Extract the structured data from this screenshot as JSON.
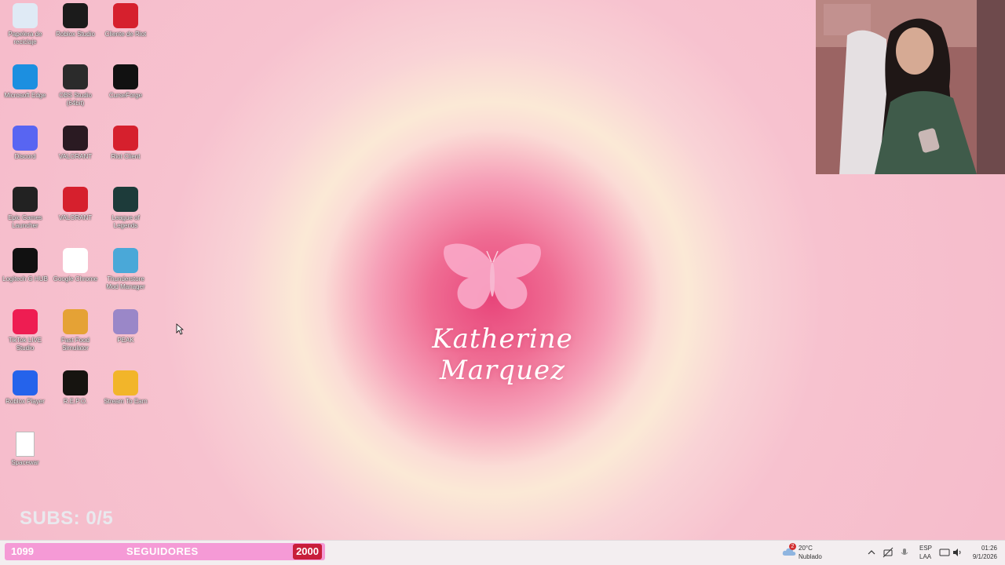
{
  "desktop": {
    "icons": [
      {
        "label": "Papelera de reciclaje",
        "icon": "recycle-bin-icon",
        "color": "#dfeaf5"
      },
      {
        "label": "Roblox Studio",
        "icon": "roblox-studio-icon",
        "color": "#1b1b1b"
      },
      {
        "label": "Cliente de Riot",
        "icon": "riot-client-icon",
        "color": "#d6202d"
      },
      {
        "label": "Microsoft Edge",
        "icon": "edge-icon",
        "color": "#1c8fe0"
      },
      {
        "label": "OBS Studio (64bit)",
        "icon": "obs-icon",
        "color": "#2b2b2b"
      },
      {
        "label": "CurseForge",
        "icon": "curseforge-icon",
        "color": "#111111"
      },
      {
        "label": "Discord",
        "icon": "discord-icon",
        "color": "#5865f2"
      },
      {
        "label": "VALORANT",
        "icon": "valorant-icon",
        "color": "#2a1a22"
      },
      {
        "label": "Riot Client",
        "icon": "riot-client-icon",
        "color": "#d6202d"
      },
      {
        "label": "Epic Games Launcher",
        "icon": "epic-games-icon",
        "color": "#222222"
      },
      {
        "label": "VALORANT",
        "icon": "riot-client-icon",
        "color": "#d6202d"
      },
      {
        "label": "League of Legends",
        "icon": "league-of-legends-icon",
        "color": "#1d3b3a"
      },
      {
        "label": "Logitech G HUB",
        "icon": "logitech-icon",
        "color": "#111111"
      },
      {
        "label": "Google Chrome",
        "icon": "chrome-icon",
        "color": "#ffffff"
      },
      {
        "label": "Thunderstore Mod Manager",
        "icon": "thunderstore-icon",
        "color": "#4aa8d8"
      },
      {
        "label": "TikTok LIVE Studio",
        "icon": "tiktok-icon",
        "color": "#ee1d52"
      },
      {
        "label": "Fast Food Simulator",
        "icon": "fast-food-simulator-icon",
        "color": "#e5a235"
      },
      {
        "label": "PEAK",
        "icon": "peak-icon",
        "color": "#9a87c8"
      },
      {
        "label": "Roblox Player",
        "icon": "roblox-player-icon",
        "color": "#2563eb"
      },
      {
        "label": "R.E.P.O.",
        "icon": "repo-icon",
        "color": "#161410"
      },
      {
        "label": "Stream To Earn",
        "icon": "stream-to-earn-icon",
        "color": "#f2b52a"
      },
      {
        "label": "Spacewar",
        "icon": "file-icon",
        "color": "#ffffff"
      }
    ]
  },
  "wallpaper": {
    "name": "Katherine Marquez",
    "accent": "#e8457a"
  },
  "overlay": {
    "subs_text": "SUBS: 0/5",
    "followers_count": "1099",
    "followers_label": "SEGUIDORES",
    "followers_goal": "2000",
    "bar_color": "#f59ad6"
  },
  "taskbar": {
    "apps": [
      "file-explorer-icon",
      "chrome-icon",
      "store-icon",
      "spotify-icon",
      "app-icon"
    ],
    "weather_badge": "2",
    "weather_temp": "20°C",
    "weather_desc": "Nublado",
    "lang_top": "ESP",
    "lang_bottom": "LAA",
    "time": "01:26",
    "date": "9/1/2026"
  }
}
